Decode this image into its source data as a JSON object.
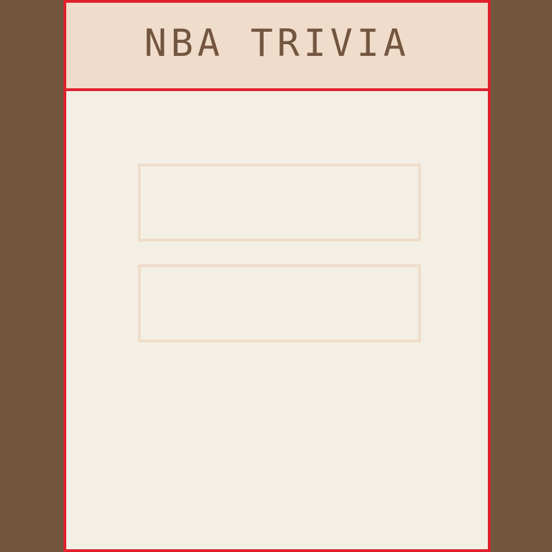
{
  "header": {
    "title": "NBA TRIVIA"
  },
  "options": [
    {
      "label": ""
    },
    {
      "label": ""
    }
  ],
  "colors": {
    "background": "#735640",
    "border": "#e0202a",
    "header_bg": "#f0dcca",
    "panel_bg": "#f3efe4",
    "text": "#735640"
  }
}
